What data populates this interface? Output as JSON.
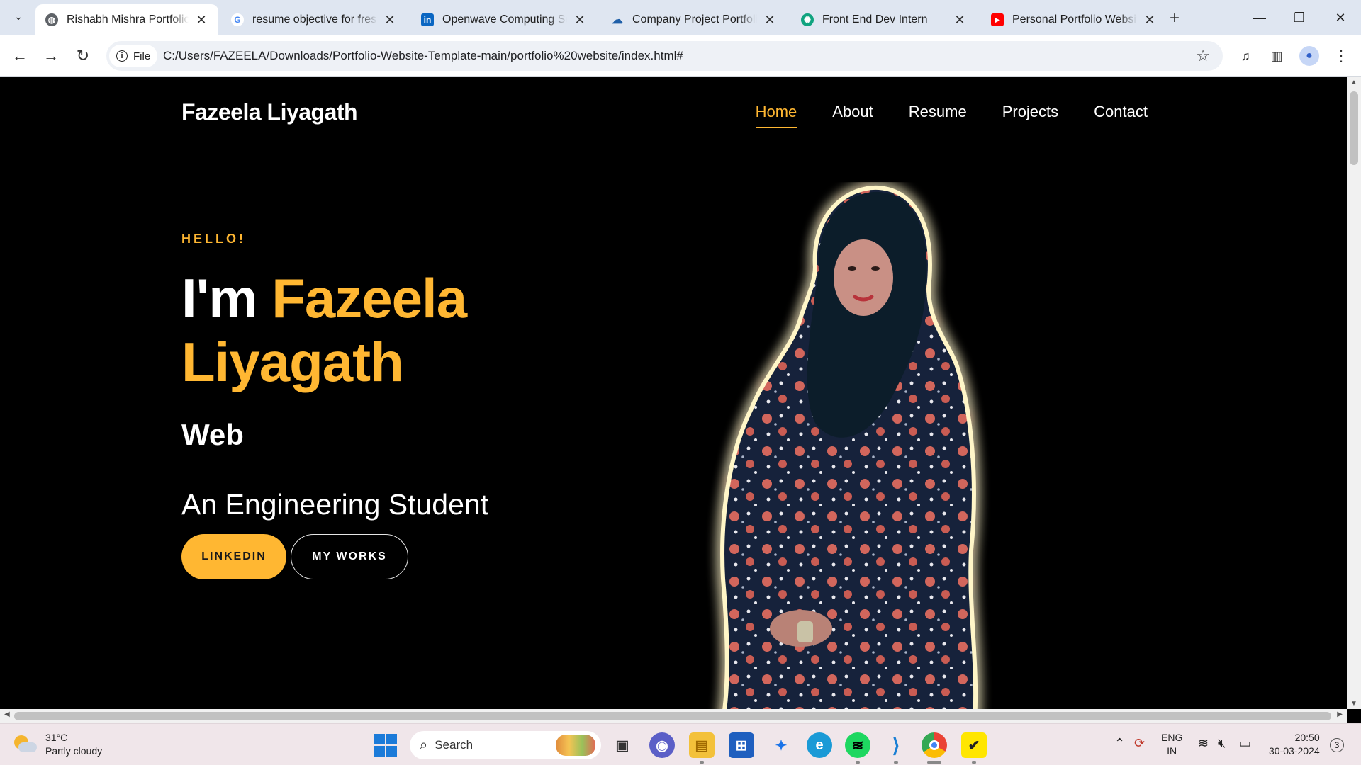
{
  "browser": {
    "tabs": [
      {
        "title": "Rishabh Mishra Portfolio",
        "favicon": "globe-icon",
        "active": true
      },
      {
        "title": "resume objective for fresh",
        "favicon": "google-icon",
        "active": false
      },
      {
        "title": "Openwave Computing Ser",
        "favicon": "linkedin-icon",
        "active": false
      },
      {
        "title": "Company Project Portfolio",
        "favicon": "cloud-icon",
        "active": false
      },
      {
        "title": "Front End Dev Intern",
        "favicon": "chatgpt-icon",
        "active": false
      },
      {
        "title": "Personal Portfolio Website",
        "favicon": "youtube-icon",
        "active": false
      }
    ],
    "address": {
      "chip": "File",
      "url": "C:/Users/FAZEELA/Downloads/Portfolio-Website-Template-main/portfolio%20website/index.html#"
    }
  },
  "site": {
    "brand": "Fazeela Liyagath",
    "nav": [
      "Home",
      "About",
      "Resume",
      "Projects",
      "Contact"
    ],
    "active_nav": "Home",
    "hero": {
      "greeting": "HELLO!",
      "im": "I'm",
      "name_first": "Fazeela",
      "name_last": "Liyagath",
      "typed": "Web",
      "tagline": "An Engineering Student",
      "primary_button": "LINKEDIN",
      "secondary_button": "MY WORKS"
    },
    "accent_color": "#ffb732"
  },
  "taskbar": {
    "weather": {
      "temp": "31°C",
      "condition": "Partly cloudy"
    },
    "search_placeholder": "Search",
    "language": [
      "ENG",
      "IN"
    ],
    "time": "20:50",
    "date": "30-03-2024",
    "notifications": "3"
  }
}
